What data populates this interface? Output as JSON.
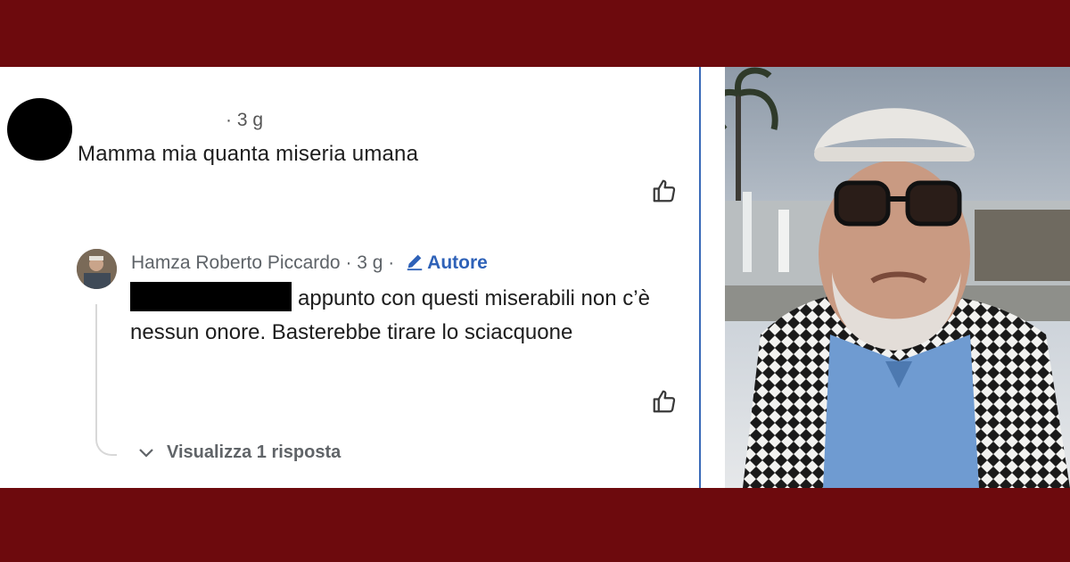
{
  "comment": {
    "time": "· 3 g",
    "text": "Mamma mia quanta miseria umana"
  },
  "reply": {
    "author": "Hamza Roberto Piccardo",
    "time": "· 3 g ·",
    "author_badge": "Autore",
    "text": "appunto con questi miserabili non c’è nessun onore. Basterebbe tirare lo sciacquone"
  },
  "view_replies_label": "Visualizza 1 risposta",
  "icons": {
    "like": "thumbs-up-icon",
    "author": "pencil-icon",
    "expand": "chevron-down-icon"
  },
  "colors": {
    "frame": "#6d0a0d",
    "author_badge": "#2f62b8",
    "separator": "#3b6bb8"
  }
}
